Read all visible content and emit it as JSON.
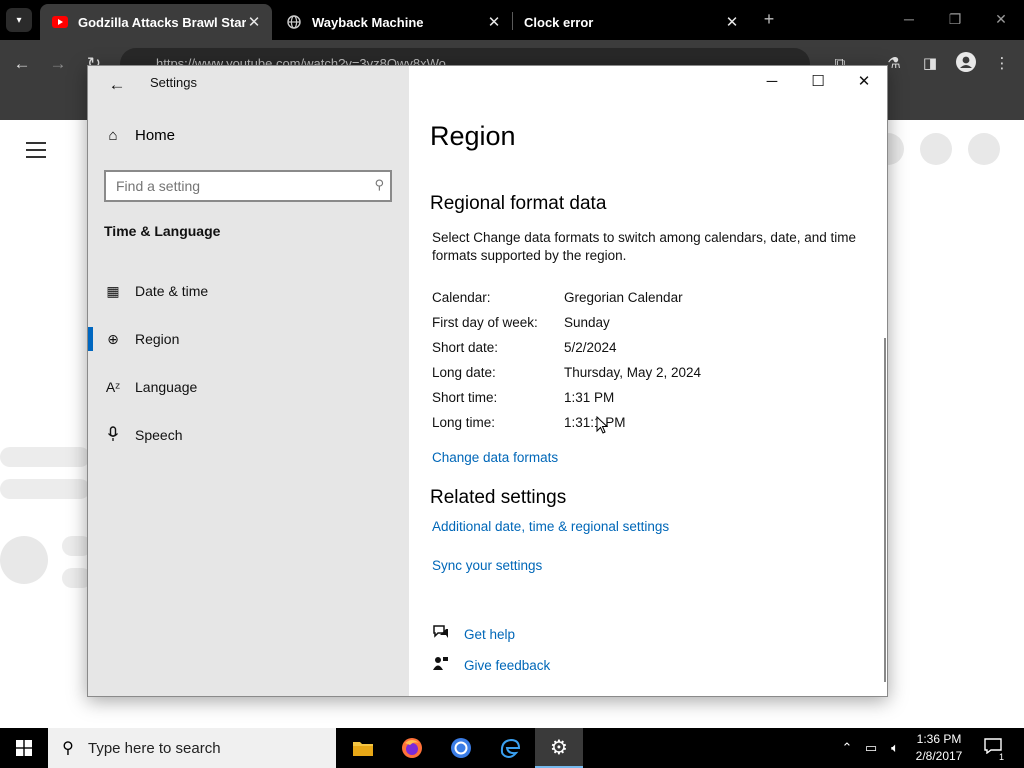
{
  "browser": {
    "tabs": [
      {
        "title": "Godzilla Attacks Brawl Stars!!!",
        "icon": "youtube-icon",
        "active": true
      },
      {
        "title": "Wayback Machine",
        "icon": "globe-icon",
        "active": false
      },
      {
        "title": "Clock error",
        "icon": "",
        "active": false
      }
    ],
    "close_glyph": "✕",
    "newtab_glyph": "+",
    "url": "https://www.youtube.com/watch?v=3yz8Owy8xWo"
  },
  "settings": {
    "app_title": "Settings",
    "home_label": "Home",
    "search_placeholder": "Find a setting",
    "section_label": "Time & Language",
    "nav_items": [
      {
        "label": "Date & time",
        "icon": "calendar-clock-icon"
      },
      {
        "label": "Region",
        "icon": "globe-icon",
        "selected": true
      },
      {
        "label": "Language",
        "icon": "language-icon"
      },
      {
        "label": "Speech",
        "icon": "microphone-icon"
      }
    ],
    "page_title": "Region",
    "format_heading": "Regional format data",
    "format_description": "Select Change data formats to switch among calendars, date, and time formats supported by the region.",
    "format_rows": [
      {
        "key": "Calendar:",
        "value": "Gregorian Calendar"
      },
      {
        "key": "First day of week:",
        "value": "Sunday"
      },
      {
        "key": "Short date:",
        "value": "5/2/2024"
      },
      {
        "key": "Long date:",
        "value": "Thursday, May 2, 2024"
      },
      {
        "key": "Short time:",
        "value": "1:31 PM"
      },
      {
        "key": "Long time:",
        "value": "1:31:1 PM"
      }
    ],
    "change_formats_link": "Change data formats",
    "related_heading": "Related settings",
    "related_links": [
      "Additional date, time & regional settings",
      "Sync your settings"
    ],
    "help_links": [
      {
        "label": "Get help",
        "icon": "chat-help-icon"
      },
      {
        "label": "Give feedback",
        "icon": "feedback-person-icon"
      }
    ]
  },
  "taskbar": {
    "search_placeholder": "Type here to search",
    "time": "1:36 PM",
    "date": "2/8/2017",
    "notification_count": "1"
  },
  "colors": {
    "accent": "#0067c0",
    "link": "#0067b8",
    "sidebar_bg": "#e6e6e6",
    "taskbar_bg": "#000000",
    "youtube_red": "#ff0000"
  }
}
